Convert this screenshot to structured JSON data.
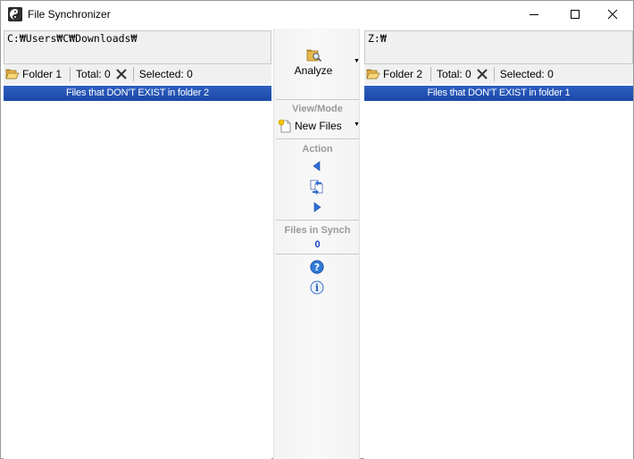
{
  "window": {
    "title": "File Synchronizer",
    "icons": {
      "app": "yin-yang-icon",
      "minimize": "minimize-icon",
      "maximize": "maximize-icon",
      "close": "close-icon"
    }
  },
  "left_pane": {
    "path": "C:₩Users₩C₩Downloads₩",
    "folder_label": "Folder 1",
    "total_label": "Total: 0",
    "selected_label": "Selected: 0",
    "header": "Files that DON'T EXIST in folder 2",
    "files": []
  },
  "right_pane": {
    "path": "Z:₩",
    "folder_label": "Folder 2",
    "total_label": "Total: 0",
    "selected_label": "Selected: 0",
    "header": "Files that DON'T EXIST in folder 1",
    "files": []
  },
  "center": {
    "analyze_label": "Analyze",
    "view_mode_title": "View/Mode",
    "view_mode_value": "New Files",
    "action_title": "Action",
    "files_in_synch_title": "Files in Synch",
    "files_in_synch_count": "0"
  },
  "colors": {
    "header_band": "#1f4fb4",
    "synch_count": "#1a3fc0",
    "section_title": "#9a9a9a"
  }
}
